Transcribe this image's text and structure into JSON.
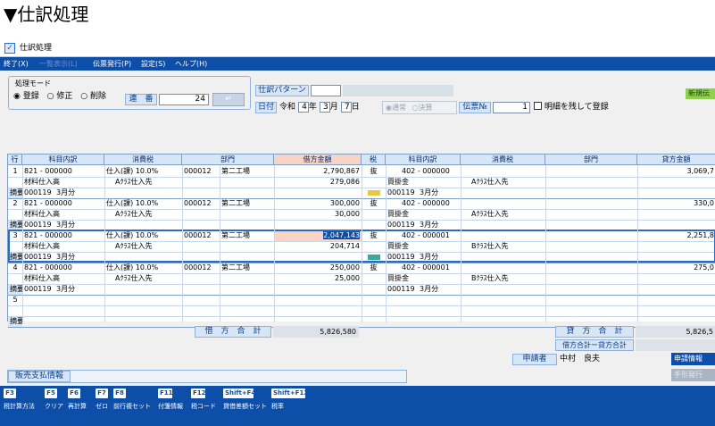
{
  "heading": "▼仕訳処理",
  "window": {
    "title": "仕訳処理"
  },
  "menu": {
    "items": [
      "終了(X)",
      "一覧表示(L)",
      "伝票発行(P)",
      "設定(S)",
      "ヘルプ(H)"
    ]
  },
  "mode": {
    "title": "処理モード",
    "options": [
      "登録",
      "修正",
      "削除"
    ],
    "selected": "登録"
  },
  "serial": {
    "label": "連　番",
    "value": "24"
  },
  "pattern": {
    "label": "仕訳パターン",
    "value": ""
  },
  "date": {
    "label": "日付",
    "era": "令和",
    "year": "4",
    "year_unit": "年",
    "month": "3",
    "month_unit": "月",
    "day": "7",
    "day_unit": "日"
  },
  "entry_type": {
    "options": [
      "通常",
      "決算"
    ],
    "selected": "通常"
  },
  "slip": {
    "label": "伝票№",
    "value": "1"
  },
  "keep_details": {
    "label": "明細を残して登録",
    "checked": false
  },
  "new_badge": "新規伝",
  "headers": {
    "row": "行",
    "debit_account": "科目内訳",
    "debit_tax": "消費税",
    "debit_dept": "部門",
    "debit_amount": "借方金額",
    "tax_type": "税",
    "credit_account": "科目内訳",
    "credit_tax": "消費税",
    "credit_dept": "部門",
    "credit_amount": "貸方金額"
  },
  "memo_label": "摘要",
  "rows": [
    {
      "no": "1",
      "d_code": "821 - 000000",
      "d_name": "材料仕入高",
      "d_tax": "仕入(課) 10.0%",
      "d_tax2": "Aｸﾗｽ仕入先",
      "d_dept": "000012",
      "d_dept_name": "第二工場",
      "d_amount": "2,790,867",
      "d_tax_amount": "279,086",
      "tax": "抜",
      "c_code": "402 - 000000",
      "c_name": "買掛金",
      "c_tax2": "Aｸﾗｽ仕入先",
      "c_amount": "3,069,7",
      "memo_code": "000119",
      "memo_text": "3月分",
      "c_memo_code": "000119",
      "c_memo_text": "3月分",
      "swatch": "#e8c840"
    },
    {
      "no": "2",
      "d_code": "821 - 000000",
      "d_name": "材料仕入高",
      "d_tax": "仕入(課) 10.0%",
      "d_tax2": "Aｸﾗｽ仕入先",
      "d_dept": "000012",
      "d_dept_name": "第二工場",
      "d_amount": "300,000",
      "d_tax_amount": "30,000",
      "tax": "抜",
      "c_code": "402 - 000000",
      "c_name": "買掛金",
      "c_tax2": "Aｸﾗｽ仕入先",
      "c_amount": "330,0",
      "memo_code": "000119",
      "memo_text": "3月分",
      "c_memo_code": "000119",
      "c_memo_text": "3月分",
      "swatch": ""
    },
    {
      "no": "3",
      "d_code": "821 - 000000",
      "d_name": "材料仕入高",
      "d_tax": "仕入(課) 10.0%",
      "d_tax2": "Aｸﾗｽ仕入先",
      "d_dept": "000012",
      "d_dept_name": "第二工場",
      "d_amount": "2,047,143",
      "d_tax_amount": "204,714",
      "tax": "抜",
      "c_code": "402 - 000001",
      "c_name": "買掛金",
      "c_tax2": "Bｸﾗｽ仕入先",
      "c_amount": "2,251,8",
      "memo_code": "000119",
      "memo_text": "3月分",
      "c_memo_code": "000119",
      "c_memo_text": "3月分",
      "swatch": "#3aa89a"
    },
    {
      "no": "4",
      "d_code": "821 - 000000",
      "d_name": "材料仕入高",
      "d_tax": "仕入(課) 10.0%",
      "d_tax2": "Aｸﾗｽ仕入先",
      "d_dept": "000012",
      "d_dept_name": "第二工場",
      "d_amount": "250,000",
      "d_tax_amount": "25,000",
      "tax": "抜",
      "c_code": "402 - 000001",
      "c_name": "買掛金",
      "c_tax2": "Bｸﾗｽ仕入先",
      "c_amount": "275,0",
      "memo_code": "000119",
      "memo_text": "3月分",
      "c_memo_code": "000119",
      "c_memo_text": "3月分",
      "swatch": ""
    },
    {
      "no": "5",
      "d_code": "",
      "d_name": "",
      "d_tax": "",
      "d_tax2": "",
      "d_dept": "",
      "d_dept_name": "",
      "d_amount": "",
      "d_tax_amount": "",
      "tax": "",
      "c_code": "",
      "c_name": "",
      "c_tax2": "",
      "c_amount": "",
      "memo_code": "",
      "memo_text": "",
      "c_memo_code": "",
      "c_memo_text": "",
      "swatch": ""
    }
  ],
  "totals": {
    "debit_label": "借　方　合　計",
    "debit_value": "5,826,580",
    "credit_label": "貸　方　合　計",
    "credit_value": "5,826,5",
    "diff_label": "借方合計ー貸方合計",
    "diff_value": ""
  },
  "applicant": {
    "label": "申請者",
    "name": "中村　良夫",
    "button": "申請情報",
    "button2": "手形発行"
  },
  "vendor_info": {
    "label": "販売支払情報"
  },
  "fkeys": [
    {
      "key": "F3",
      "label": "税計算方法"
    },
    {
      "key": "F5",
      "label": "クリア"
    },
    {
      "key": "F6",
      "label": "再計算"
    },
    {
      "key": "F7",
      "label": "ゼロ"
    },
    {
      "key": "F8",
      "label": "前行複セット"
    },
    {
      "key": "F11",
      "label": "付箋情報"
    },
    {
      "key": "F12",
      "label": "税コード"
    },
    {
      "key": "Shift+F4",
      "label": "貸借差額セット"
    },
    {
      "key": "Shift+F12",
      "label": "税率"
    }
  ],
  "colors": {
    "accent": "#0d4ea8",
    "header_bg": "#d6e6f7",
    "highlight": "#f9d3c4"
  }
}
